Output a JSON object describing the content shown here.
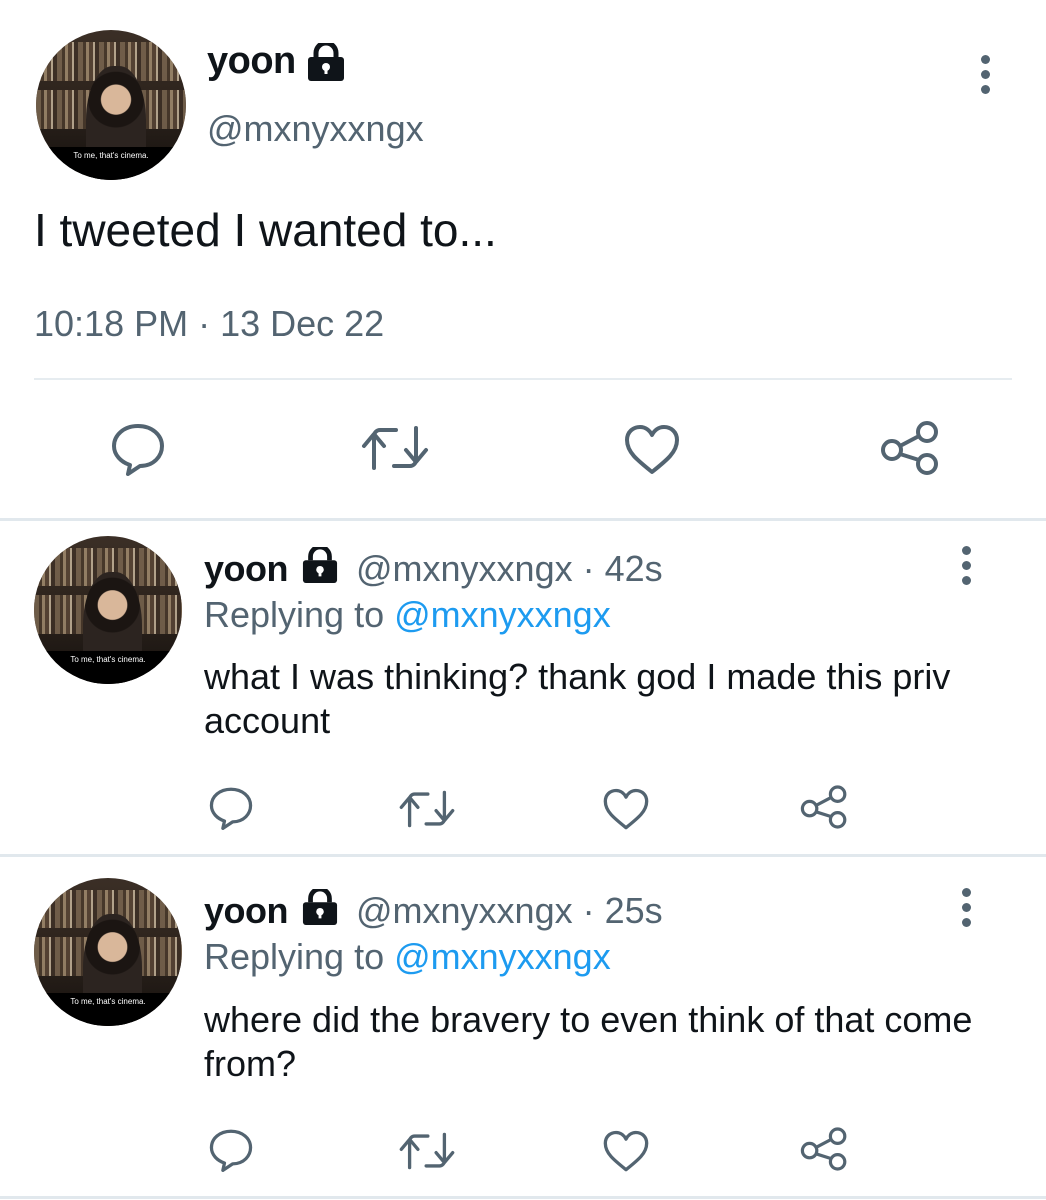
{
  "main_tweet": {
    "display_name": "yoon",
    "handle": "@mxnyxxngx",
    "text": "I tweeted I wanted to...",
    "timestamp": "10:18 PM · 13 Dec 22",
    "avatar_caption": "To me, that's cinema."
  },
  "replies": [
    {
      "display_name": "yoon",
      "handle_time": "@mxnyxxngx · 42s",
      "replying_prefix": "Replying to ",
      "replying_handle": "@mxnyxxngx",
      "text": "what I was thinking? thank god I made this priv account",
      "avatar_caption": "To me, that's cinema."
    },
    {
      "display_name": "yoon",
      "handle_time": "@mxnyxxngx · 25s",
      "replying_prefix": "Replying to ",
      "replying_handle": "@mxnyxxngx",
      "text": "where did the bravery to even think of that come from?",
      "avatar_caption": "To me, that's cinema."
    }
  ],
  "icons": [
    "lock-icon",
    "more-icon",
    "reply-icon",
    "retweet-icon",
    "like-icon",
    "share-icon"
  ],
  "colors": {
    "text": "#0f1419",
    "secondary": "#536471",
    "link": "#1d9bf0",
    "divider": "#e6ecf0"
  }
}
